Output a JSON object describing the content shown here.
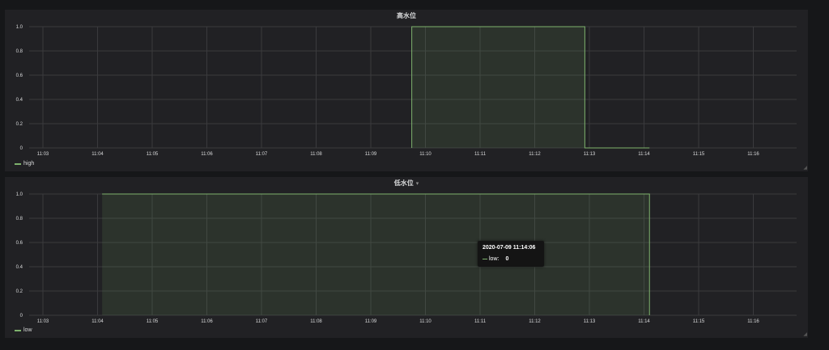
{
  "panels": [
    {
      "title": "高水位",
      "legend": "high",
      "chart_data": {
        "type": "area",
        "x": [
          "11:09:45",
          "11:09:45",
          "11:12:55",
          "11:12:55",
          "11:14:06"
        ],
        "series": [
          {
            "name": "high",
            "values": [
              0,
              1,
              1,
              0,
              0
            ]
          }
        ],
        "x_ticks": [
          "11:03",
          "11:04",
          "11:05",
          "11:06",
          "11:07",
          "11:08",
          "11:09",
          "11:10",
          "11:11",
          "11:12",
          "11:13",
          "11:14",
          "11:15",
          "11:16"
        ],
        "y_ticks": [
          "0",
          "0.2",
          "0.4",
          "0.6",
          "0.8",
          "1.0"
        ],
        "ylim": [
          0,
          1
        ],
        "grid": true,
        "color": "#7eb26d"
      }
    },
    {
      "title": "低水位",
      "legend": "low",
      "chart_data": {
        "type": "area",
        "x": [
          "11:04:05",
          "11:14:06",
          "11:14:06"
        ],
        "series": [
          {
            "name": "low",
            "values": [
              1,
              1,
              0
            ]
          }
        ],
        "x_ticks": [
          "11:03",
          "11:04",
          "11:05",
          "11:06",
          "11:07",
          "11:08",
          "11:09",
          "11:10",
          "11:11",
          "11:12",
          "11:13",
          "11:14",
          "11:15",
          "11:16"
        ],
        "y_ticks": [
          "0",
          "0.2",
          "0.4",
          "0.6",
          "0.8",
          "1.0"
        ],
        "ylim": [
          0,
          1
        ],
        "grid": true,
        "color": "#7eb26d"
      }
    }
  ],
  "tooltip": {
    "time": "2020-07-09 11:14:06",
    "series": "low:",
    "value": "0"
  }
}
